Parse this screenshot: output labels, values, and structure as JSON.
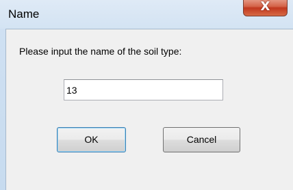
{
  "window": {
    "title": "Name",
    "close_icon": "close-icon",
    "close_glyph": "X"
  },
  "dialog": {
    "prompt": "Please input the name of the soil type:",
    "name_field": {
      "value": "13",
      "placeholder": ""
    },
    "ok_label": "OK",
    "cancel_label": "Cancel"
  },
  "colors": {
    "close_button": "#c9452b",
    "dialog_background": "#f0f0f0",
    "title_background": "#d3e3f3",
    "default_button_border": "#3c7fb1"
  }
}
